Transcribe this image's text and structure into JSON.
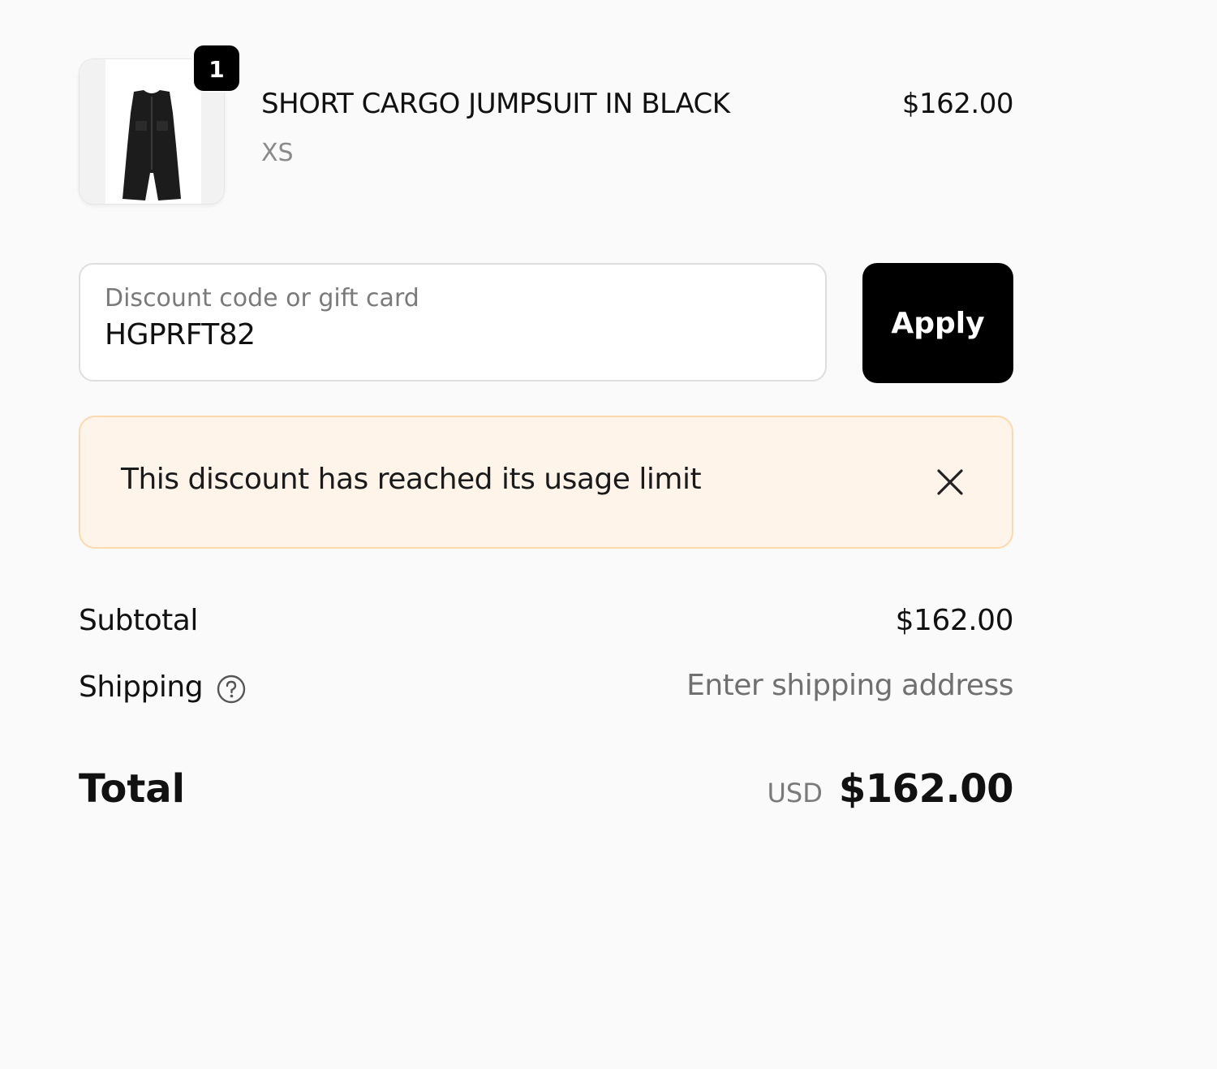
{
  "product": {
    "quantity": "1",
    "name": "SHORT CARGO JUMPSUIT IN BLACK",
    "variant": "XS",
    "price": "$162.00",
    "image_icon": "jumpsuit-thumbnail"
  },
  "discount": {
    "label": "Discount code or gift card",
    "value": "HGPRFT82",
    "apply_label": "Apply"
  },
  "notice": {
    "message": "This discount has reached its usage limit",
    "close_icon": "close-icon",
    "background": "#fff4ea",
    "border": "#ffd9ac"
  },
  "totals": {
    "subtotal_label": "Subtotal",
    "subtotal_value": "$162.00",
    "shipping_label": "Shipping",
    "shipping_help_icon": "question-circle-icon",
    "shipping_value": "Enter shipping address",
    "total_label": "Total",
    "currency": "USD",
    "total_value": "$162.00"
  }
}
